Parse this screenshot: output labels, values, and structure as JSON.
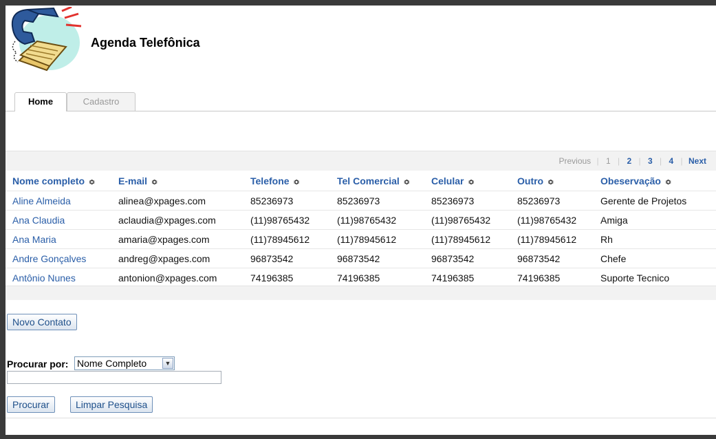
{
  "app": {
    "title": "Agenda Telefônica"
  },
  "tabs": [
    {
      "label": "Home"
    },
    {
      "label": "Cadastro"
    }
  ],
  "pager": {
    "previous": "Previous",
    "pages": [
      "1",
      "2",
      "3",
      "4"
    ],
    "current": "1",
    "next": "Next"
  },
  "table": {
    "sort_glyph": "≎",
    "columns": [
      "Nome completo",
      "E-mail",
      "Telefone",
      "Tel Comercial",
      "Celular",
      "Outro",
      "Obeservação"
    ],
    "rows": [
      [
        "Aline Almeida",
        "alinea@xpages.com",
        "85236973",
        "85236973",
        "85236973",
        "85236973",
        "Gerente de Projetos"
      ],
      [
        "Ana Claudia",
        "aclaudia@xpages.com",
        "(11)98765432",
        "(11)98765432",
        "(11)98765432",
        "(11)98765432",
        "Amiga"
      ],
      [
        "Ana Maria",
        "amaria@xpages.com",
        "(11)78945612",
        "(11)78945612",
        "(11)78945612",
        "(11)78945612",
        "Rh"
      ],
      [
        "Andre Gonçalves",
        "andreg@xpages.com",
        "96873542",
        "96873542",
        "96873542",
        "96873542",
        "Chefe"
      ],
      [
        "Antônio Nunes",
        "antonion@xpages.com",
        "74196385",
        "74196385",
        "74196385",
        "74196385",
        "Suporte Tecnico"
      ]
    ]
  },
  "actions": {
    "new_contact": "Novo Contato",
    "search": "Procurar",
    "clear_search": "Limpar Pesquisa"
  },
  "search": {
    "label": "Procurar por:",
    "field_selected": "Nome Completo",
    "query": ""
  },
  "colors": {
    "link": "#2a5ea8",
    "button_text": "#1e4f8a",
    "grid_band": "#f2f2f2",
    "backdrop": "#3a3a3a"
  }
}
